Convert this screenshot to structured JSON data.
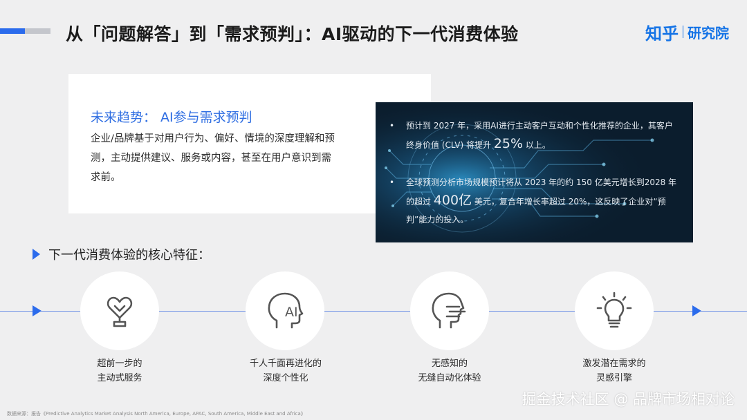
{
  "header": {
    "title": "从「问题解答」到「需求预判」：AI驱动的下一代消费体验",
    "brand_main": "知乎",
    "brand_sub": "研究院"
  },
  "trend": {
    "title": "未来趋势： AI参与需求预判",
    "body": "企业/品牌基于对用户行为、偏好、情境的深度理解和预测，主动提供建议、服务或内容，甚至在用户意识到需求前。"
  },
  "stats": [
    {
      "pre": "预计到 2027 年，采用AI进行主动客户互动和个性化推荐的企业，其客户终身价值 (CLV) 将提升 ",
      "highlight": "25%",
      "post": " 以上。"
    },
    {
      "pre": "全球预测分析市场规模预计将从 2023 年的约 150 亿美元增长到2028 年的超过 ",
      "highlight": "400亿",
      "post": " 美元，复合年增长率超过 20%，这反映了企业对“预判”能力的投入。"
    }
  ],
  "section": {
    "heading": "下一代消费体验的核心特征："
  },
  "features": [
    {
      "icon": "heart-trophy-icon",
      "line1": "超前一步的",
      "line2": "主动式服务"
    },
    {
      "icon": "ai-head-icon",
      "line1": "千人千面再进化的",
      "line2": "深度个性化"
    },
    {
      "icon": "speaking-head-icon",
      "line1": "无感知的",
      "line2": "无缝自动化体验"
    },
    {
      "icon": "lightbulb-icon",
      "line1": "激发潜在需求的",
      "line2": "灵感引擎"
    }
  ],
  "footer": {
    "source": "数据来源：报告《Predictive Analytics Market Analysis North America, Europe, APAC, South America, Middle East and Africa》",
    "watermark": "掘金技术社区 @ 品牌市场相对论"
  },
  "colors": {
    "accent": "#2b6bec",
    "brand": "#1473e6",
    "panel": "#0b1d2d",
    "background": "#efeff0"
  }
}
